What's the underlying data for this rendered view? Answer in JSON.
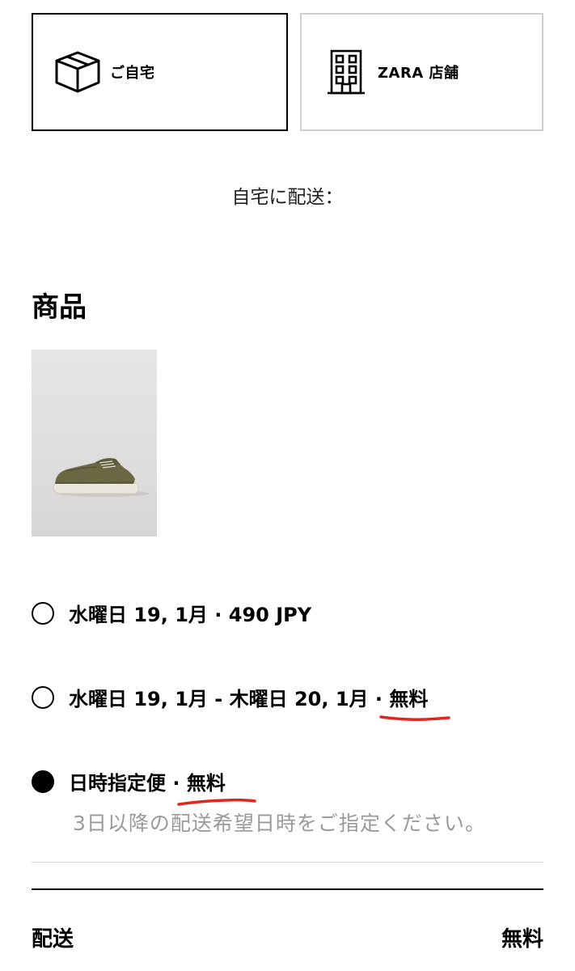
{
  "delivery_tabs": {
    "home": {
      "label": "ご自宅",
      "icon": "box-icon",
      "selected": true
    },
    "store": {
      "label": "ZARA 店舗",
      "icon": "store-building-icon",
      "selected": false
    }
  },
  "ship_to_label": "自宅に配送：",
  "products_section": {
    "title": "商品",
    "items": [
      {
        "image": "sneaker-olive-suede",
        "image_alt": ""
      }
    ]
  },
  "shipping_options": [
    {
      "text": "水曜日 19, 1月 · 490 JPY",
      "selected": false
    },
    {
      "text_prefix": "水曜日 19, 1月 - 木曜日 20, 1月 · ",
      "text_highlight": "無料",
      "selected": false
    },
    {
      "text_prefix": "日時指定便 · ",
      "text_highlight": "無料",
      "subtext": "3日以降の配送希望日時をご指定ください。",
      "selected": true
    }
  ],
  "summary": {
    "shipping_label": "配送",
    "shipping_value": "無料"
  },
  "colors": {
    "accent_underline": "#e0261e",
    "selected_border": "#000000",
    "unselected_border": "#cfcfcf",
    "subtext": "#9a9a9a"
  }
}
